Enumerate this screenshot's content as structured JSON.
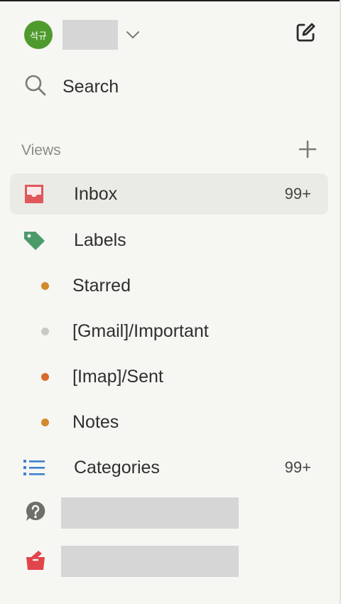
{
  "account": {
    "avatar_text": "석규",
    "avatar_color": "#4f9a2c"
  },
  "toolbar": {
    "compose_icon": "compose-icon"
  },
  "search": {
    "label": "Search"
  },
  "views": {
    "header": "Views",
    "add_label": "+"
  },
  "nav": {
    "inbox": {
      "label": "Inbox",
      "count": "99+",
      "icon_color": "#e0585b"
    },
    "labels": {
      "label": "Labels",
      "icon_color": "#4c9a6a"
    },
    "sub_labels": [
      {
        "label": "Starred",
        "dot_color": "#d18a2c"
      },
      {
        "label": "[Gmail]/Important",
        "dot_color": "#c8c8c4"
      },
      {
        "label": "[Imap]/Sent",
        "dot_color": "#d86b2c"
      },
      {
        "label": "Notes",
        "dot_color": "#d18a2c"
      }
    ],
    "categories": {
      "label": "Categories",
      "count": "99+",
      "icon_color": "#3f7fd0"
    },
    "help": {
      "icon_color": "#6e6e6a"
    },
    "redbox": {
      "icon_color": "#e0454b"
    }
  }
}
